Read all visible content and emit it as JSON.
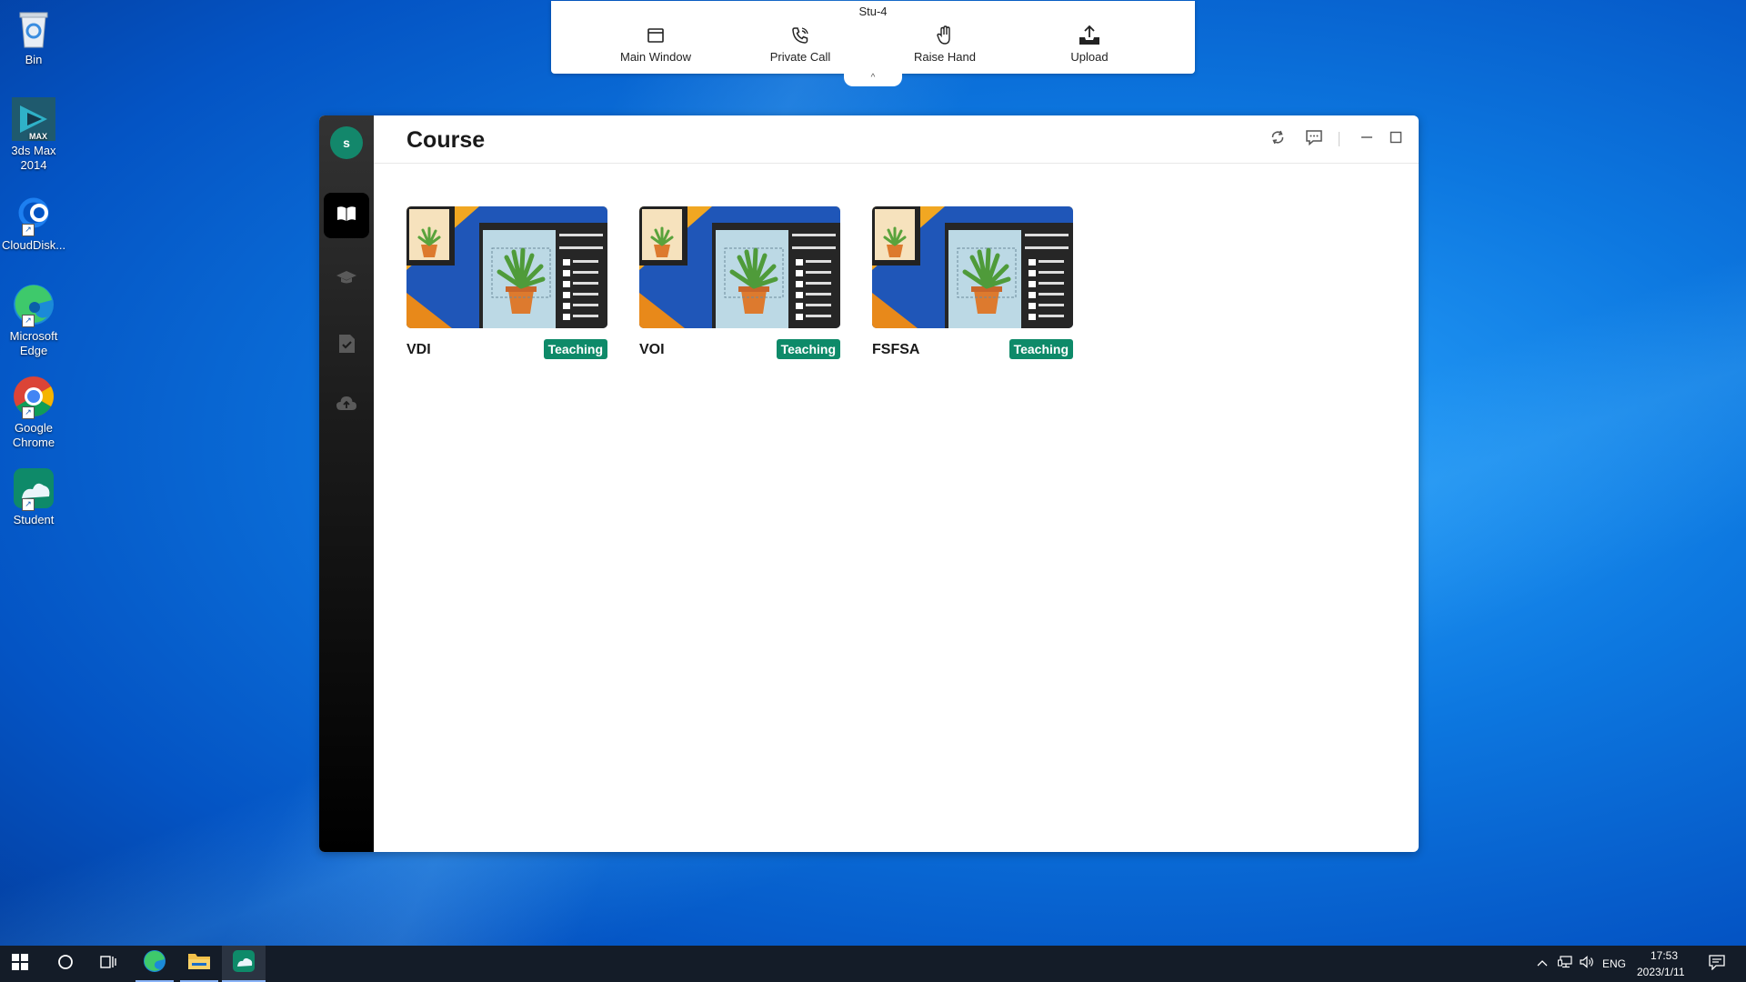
{
  "desktop": {
    "icons": [
      {
        "label": "Bin",
        "icon": "recycle-bin-icon"
      },
      {
        "label": "3ds Max 2014",
        "icon": "3ds-max-icon",
        "badge": "MAX"
      },
      {
        "label": "CloudDisk...",
        "icon": "cloud-disk-icon"
      },
      {
        "label": "Microsoft Edge",
        "icon": "edge-icon"
      },
      {
        "label": "Google Chrome",
        "icon": "chrome-icon"
      },
      {
        "label": "Student",
        "icon": "student-app-icon"
      }
    ]
  },
  "floating_toolbar": {
    "title": "Stu-4",
    "buttons": [
      {
        "label": "Main Window",
        "icon": "window-icon"
      },
      {
        "label": "Private Call",
        "icon": "phone-call-icon"
      },
      {
        "label": "Raise Hand",
        "icon": "hand-icon"
      },
      {
        "label": "Upload",
        "icon": "upload-icon"
      }
    ],
    "collapse_glyph": "^"
  },
  "app": {
    "avatar_letter": "s",
    "nav": [
      {
        "name": "courses",
        "icon": "book-open-icon",
        "active": true
      },
      {
        "name": "classes",
        "icon": "graduation-cap-icon",
        "active": false
      },
      {
        "name": "assignments",
        "icon": "checklist-icon",
        "active": false
      },
      {
        "name": "uploads",
        "icon": "cloud-upload-icon",
        "active": false
      }
    ],
    "header": {
      "title": "Course",
      "actions": [
        "refresh-icon",
        "message-icon",
        "minimize-icon",
        "maximize-icon"
      ]
    },
    "courses": [
      {
        "name": "VDI",
        "status": "Teaching"
      },
      {
        "name": "VOI",
        "status": "Teaching"
      },
      {
        "name": "FSFSA",
        "status": "Teaching"
      }
    ]
  },
  "taskbar": {
    "apps": [
      "windows-start-icon",
      "search-circle-icon",
      "task-view-icon",
      "edge-icon",
      "file-explorer-icon",
      "student-app-icon"
    ],
    "language": "ENG",
    "time": "17:53",
    "date": "2023/1/11"
  },
  "colors": {
    "accent": "#0e8a69",
    "avatar": "#13876b",
    "taskbar": "#141c28"
  }
}
